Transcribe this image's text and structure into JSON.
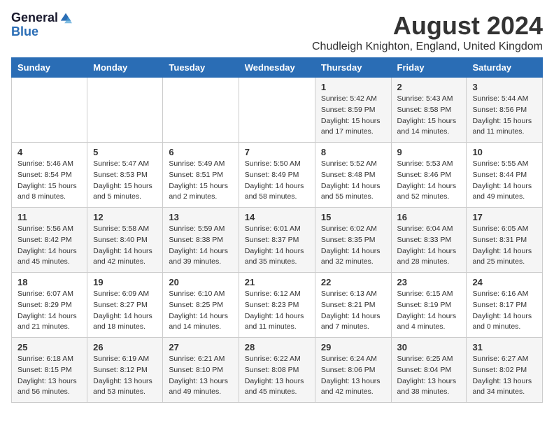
{
  "logo": {
    "general": "General",
    "blue": "Blue"
  },
  "title": "August 2024",
  "subtitle": "Chudleigh Knighton, England, United Kingdom",
  "days_of_week": [
    "Sunday",
    "Monday",
    "Tuesday",
    "Wednesday",
    "Thursday",
    "Friday",
    "Saturday"
  ],
  "weeks": [
    [
      {
        "day": "",
        "sunrise": "",
        "sunset": "",
        "daylight": ""
      },
      {
        "day": "",
        "sunrise": "",
        "sunset": "",
        "daylight": ""
      },
      {
        "day": "",
        "sunrise": "",
        "sunset": "",
        "daylight": ""
      },
      {
        "day": "",
        "sunrise": "",
        "sunset": "",
        "daylight": ""
      },
      {
        "day": "1",
        "sunrise": "Sunrise: 5:42 AM",
        "sunset": "Sunset: 8:59 PM",
        "daylight": "Daylight: 15 hours and 17 minutes."
      },
      {
        "day": "2",
        "sunrise": "Sunrise: 5:43 AM",
        "sunset": "Sunset: 8:58 PM",
        "daylight": "Daylight: 15 hours and 14 minutes."
      },
      {
        "day": "3",
        "sunrise": "Sunrise: 5:44 AM",
        "sunset": "Sunset: 8:56 PM",
        "daylight": "Daylight: 15 hours and 11 minutes."
      }
    ],
    [
      {
        "day": "4",
        "sunrise": "Sunrise: 5:46 AM",
        "sunset": "Sunset: 8:54 PM",
        "daylight": "Daylight: 15 hours and 8 minutes."
      },
      {
        "day": "5",
        "sunrise": "Sunrise: 5:47 AM",
        "sunset": "Sunset: 8:53 PM",
        "daylight": "Daylight: 15 hours and 5 minutes."
      },
      {
        "day": "6",
        "sunrise": "Sunrise: 5:49 AM",
        "sunset": "Sunset: 8:51 PM",
        "daylight": "Daylight: 15 hours and 2 minutes."
      },
      {
        "day": "7",
        "sunrise": "Sunrise: 5:50 AM",
        "sunset": "Sunset: 8:49 PM",
        "daylight": "Daylight: 14 hours and 58 minutes."
      },
      {
        "day": "8",
        "sunrise": "Sunrise: 5:52 AM",
        "sunset": "Sunset: 8:48 PM",
        "daylight": "Daylight: 14 hours and 55 minutes."
      },
      {
        "day": "9",
        "sunrise": "Sunrise: 5:53 AM",
        "sunset": "Sunset: 8:46 PM",
        "daylight": "Daylight: 14 hours and 52 minutes."
      },
      {
        "day": "10",
        "sunrise": "Sunrise: 5:55 AM",
        "sunset": "Sunset: 8:44 PM",
        "daylight": "Daylight: 14 hours and 49 minutes."
      }
    ],
    [
      {
        "day": "11",
        "sunrise": "Sunrise: 5:56 AM",
        "sunset": "Sunset: 8:42 PM",
        "daylight": "Daylight: 14 hours and 45 minutes."
      },
      {
        "day": "12",
        "sunrise": "Sunrise: 5:58 AM",
        "sunset": "Sunset: 8:40 PM",
        "daylight": "Daylight: 14 hours and 42 minutes."
      },
      {
        "day": "13",
        "sunrise": "Sunrise: 5:59 AM",
        "sunset": "Sunset: 8:38 PM",
        "daylight": "Daylight: 14 hours and 39 minutes."
      },
      {
        "day": "14",
        "sunrise": "Sunrise: 6:01 AM",
        "sunset": "Sunset: 8:37 PM",
        "daylight": "Daylight: 14 hours and 35 minutes."
      },
      {
        "day": "15",
        "sunrise": "Sunrise: 6:02 AM",
        "sunset": "Sunset: 8:35 PM",
        "daylight": "Daylight: 14 hours and 32 minutes."
      },
      {
        "day": "16",
        "sunrise": "Sunrise: 6:04 AM",
        "sunset": "Sunset: 8:33 PM",
        "daylight": "Daylight: 14 hours and 28 minutes."
      },
      {
        "day": "17",
        "sunrise": "Sunrise: 6:05 AM",
        "sunset": "Sunset: 8:31 PM",
        "daylight": "Daylight: 14 hours and 25 minutes."
      }
    ],
    [
      {
        "day": "18",
        "sunrise": "Sunrise: 6:07 AM",
        "sunset": "Sunset: 8:29 PM",
        "daylight": "Daylight: 14 hours and 21 minutes."
      },
      {
        "day": "19",
        "sunrise": "Sunrise: 6:09 AM",
        "sunset": "Sunset: 8:27 PM",
        "daylight": "Daylight: 14 hours and 18 minutes."
      },
      {
        "day": "20",
        "sunrise": "Sunrise: 6:10 AM",
        "sunset": "Sunset: 8:25 PM",
        "daylight": "Daylight: 14 hours and 14 minutes."
      },
      {
        "day": "21",
        "sunrise": "Sunrise: 6:12 AM",
        "sunset": "Sunset: 8:23 PM",
        "daylight": "Daylight: 14 hours and 11 minutes."
      },
      {
        "day": "22",
        "sunrise": "Sunrise: 6:13 AM",
        "sunset": "Sunset: 8:21 PM",
        "daylight": "Daylight: 14 hours and 7 minutes."
      },
      {
        "day": "23",
        "sunrise": "Sunrise: 6:15 AM",
        "sunset": "Sunset: 8:19 PM",
        "daylight": "Daylight: 14 hours and 4 minutes."
      },
      {
        "day": "24",
        "sunrise": "Sunrise: 6:16 AM",
        "sunset": "Sunset: 8:17 PM",
        "daylight": "Daylight: 14 hours and 0 minutes."
      }
    ],
    [
      {
        "day": "25",
        "sunrise": "Sunrise: 6:18 AM",
        "sunset": "Sunset: 8:15 PM",
        "daylight": "Daylight: 13 hours and 56 minutes."
      },
      {
        "day": "26",
        "sunrise": "Sunrise: 6:19 AM",
        "sunset": "Sunset: 8:12 PM",
        "daylight": "Daylight: 13 hours and 53 minutes."
      },
      {
        "day": "27",
        "sunrise": "Sunrise: 6:21 AM",
        "sunset": "Sunset: 8:10 PM",
        "daylight": "Daylight: 13 hours and 49 minutes."
      },
      {
        "day": "28",
        "sunrise": "Sunrise: 6:22 AM",
        "sunset": "Sunset: 8:08 PM",
        "daylight": "Daylight: 13 hours and 45 minutes."
      },
      {
        "day": "29",
        "sunrise": "Sunrise: 6:24 AM",
        "sunset": "Sunset: 8:06 PM",
        "daylight": "Daylight: 13 hours and 42 minutes."
      },
      {
        "day": "30",
        "sunrise": "Sunrise: 6:25 AM",
        "sunset": "Sunset: 8:04 PM",
        "daylight": "Daylight: 13 hours and 38 minutes."
      },
      {
        "day": "31",
        "sunrise": "Sunrise: 6:27 AM",
        "sunset": "Sunset: 8:02 PM",
        "daylight": "Daylight: 13 hours and 34 minutes."
      }
    ]
  ]
}
